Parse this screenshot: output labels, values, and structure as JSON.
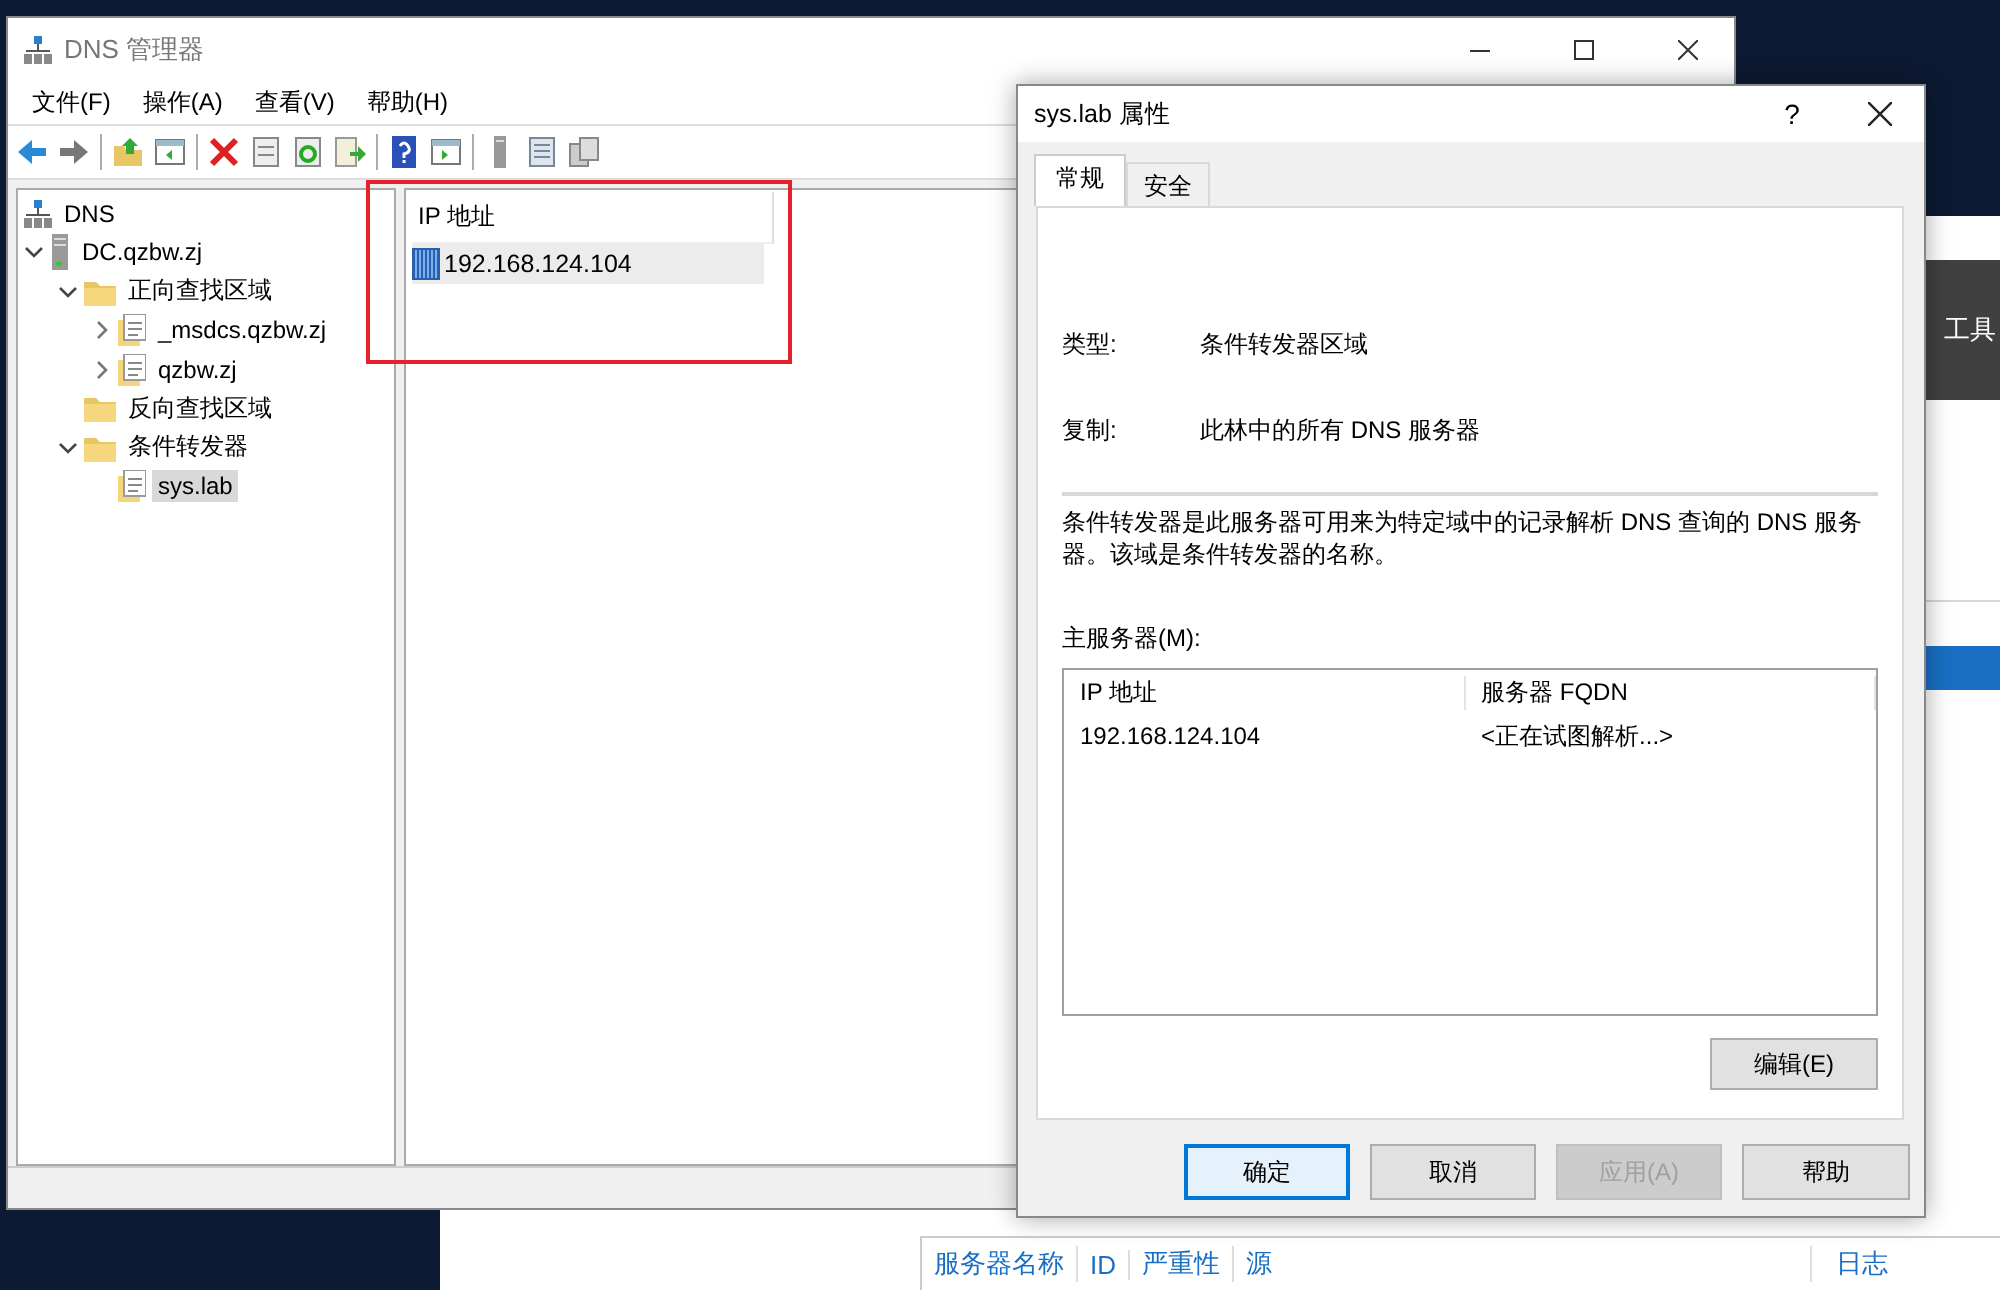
{
  "background_window": {
    "toolbar_label": "工具",
    "columns": [
      "服务器名称",
      "ID",
      "严重性",
      "源",
      "日志"
    ]
  },
  "window": {
    "title": "DNS 管理器",
    "menu": [
      "文件(F)",
      "操作(A)",
      "查看(V)",
      "帮助(H)"
    ],
    "tree": [
      {
        "label": "DNS",
        "kind": "dns",
        "selected": false,
        "children": [
          {
            "label": "DC.qzbw.zj",
            "kind": "server",
            "expanded": true,
            "selected": false,
            "children": [
              {
                "label": "正向查找区域",
                "kind": "folder",
                "expanded": true,
                "selected": false,
                "children": [
                  {
                    "label": "_msdcs.qzbw.zj",
                    "kind": "zone",
                    "expanded": false,
                    "selected": false
                  },
                  {
                    "label": "qzbw.zj",
                    "kind": "zone",
                    "expanded": false,
                    "selected": false
                  }
                ]
              },
              {
                "label": "反向查找区域",
                "kind": "folder",
                "selected": false
              },
              {
                "label": "条件转发器",
                "kind": "folder",
                "expanded": true,
                "selected": false,
                "children": [
                  {
                    "label": "sys.lab",
                    "kind": "zone",
                    "selected": true
                  }
                ]
              }
            ]
          }
        ]
      }
    ],
    "list": {
      "columns": [
        "IP 地址"
      ],
      "rows": [
        {
          "ip": "192.168.124.104",
          "selected": true
        }
      ]
    }
  },
  "dialog": {
    "title": "sys.lab 属性",
    "help": "?",
    "tabs": [
      {
        "label": "常规",
        "selected": true
      },
      {
        "label": "安全",
        "selected": false
      }
    ],
    "fields": [
      {
        "label": "类型:",
        "value": "条件转发器区域"
      },
      {
        "label": "复制:",
        "value": "此林中的所有 DNS 服务器"
      }
    ],
    "description": "条件转发器是此服务器可用来为特定域中的记录解析 DNS 查询的 DNS 服务器。该域是条件转发器的名称。",
    "masters_label": "主服务器(M):",
    "masters": {
      "columns": [
        "IP 地址",
        "服务器 FQDN"
      ],
      "rows": [
        [
          "192.168.124.104",
          "<正在试图解析...>"
        ]
      ]
    },
    "edit_button": "编辑(E)",
    "buttons": [
      {
        "label": "确定",
        "default": true,
        "disabled": false
      },
      {
        "label": "取消",
        "default": false,
        "disabled": false
      },
      {
        "label": "应用(A)",
        "default": false,
        "disabled": true
      },
      {
        "label": "帮助",
        "default": false,
        "disabled": false
      }
    ]
  }
}
